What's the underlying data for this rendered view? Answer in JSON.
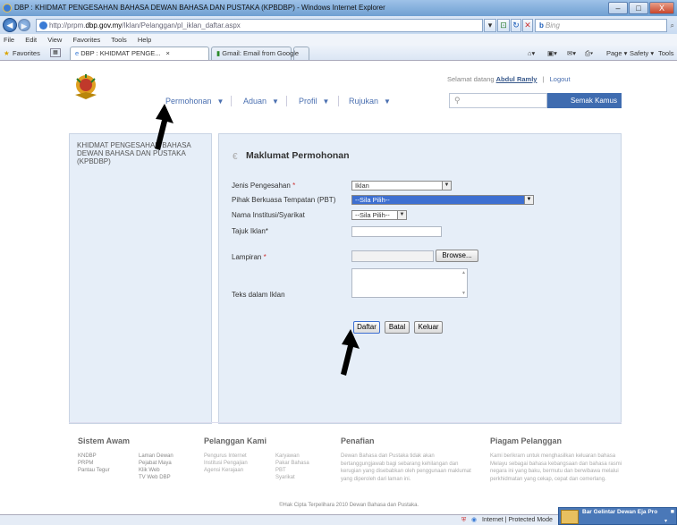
{
  "window": {
    "title": "DBP : KHIDMAT PENGESAHAN BAHASA DEWAN BAHASA DAN PUSTAKA (KPBDBP) - Windows Internet Explorer",
    "min": "–",
    "max": "□",
    "close": "X"
  },
  "address": {
    "url_prefix": "http://prpm.",
    "url_domain": "dbp.gov.my",
    "url_suffix": "/Iklan/Pelanggan/pl_iklan_daftar.aspx",
    "search_engine": "Bing"
  },
  "menu": [
    "File",
    "Edit",
    "View",
    "Favorites",
    "Tools",
    "Help"
  ],
  "favorites": {
    "label": "Favorites",
    "tab1": "DBP : KHIDMAT PENGE...",
    "tab2": "Gmail: Email from Google",
    "commands": [
      "Page ▾",
      "Safety ▾",
      "Tools ▾"
    ]
  },
  "header": {
    "welcome_prefix": "Selamat datang",
    "user": "Abdul Ramly",
    "logout": "Logout",
    "nav": [
      "Permohonan",
      "Aduan",
      "Profil",
      "Rujukan"
    ],
    "search_button": "Semak Kamus"
  },
  "sidebar": {
    "org": "KHIDMAT PENGESAHAN BAHASA DEWAN BAHASA DAN PUSTAKA (KPBDBP)"
  },
  "form": {
    "title": "Maklumat Permohonan",
    "fields": {
      "jenis_label": "Jenis Pengesahan",
      "jenis_value": "Iklan",
      "pbt_label": "Pihak Berkuasa Tempatan (PBT)",
      "pbt_value": "--Sila Pilih--",
      "institusi_label": "Nama Institusi/Syarikat",
      "institusi_value": "--Sila Pilih--",
      "tajuk_label": "Tajuk Iklan*",
      "lampiran_label": "Lampiran",
      "browse": "Browse...",
      "teks_label": "Teks dalam Iklan"
    },
    "buttons": {
      "daftar": "Daftar",
      "batal": "Batal",
      "keluar": "Keluar"
    }
  },
  "footer": {
    "col1_head": "Sistem Awam",
    "col1_a": [
      "KNDBP",
      "PRPM",
      "Pantau Tegur"
    ],
    "col1_b": [
      "Laman Dewan",
      "Pejabat Maya",
      "Klik Web",
      "TV Web DBP"
    ],
    "col2_head": "Pelanggan Kami",
    "col2_a": [
      "Pengurus Internet",
      "Institusi Pengajian",
      "Agensi Kerajaan"
    ],
    "col2_b": [
      "Karyawan",
      "Pakar Bahasa",
      "PBT",
      "Syarikat"
    ],
    "col3_head": "Penafian",
    "col3_text": "Dewan Bahasa dan Pustaka tidak akan bertanggungjawab bagi sebarang kehilangan dan kerugian yang disebabkan oleh penggunaan maklumat yang diperoleh dari laman ini.",
    "col4_head": "Piagam Pelanggan",
    "col4_text": "Kami berikrarn untuk menghasilkan keluaran bahasa Melayu sebagai bahasa kebangsaan dan bahasa rasmi negara ini yang baku, bermutu dan berwibawa melalui perkhidmatan yang cekap, cepat dan cemerlang.",
    "copyright": "©Hak Cipta Terpelihara 2010 Dewan Bahasa dan Pustaka."
  },
  "status": {
    "zone": "Internet | Protected Mode",
    "notification": "Bar Gelintar Dewan Eja Pro"
  }
}
